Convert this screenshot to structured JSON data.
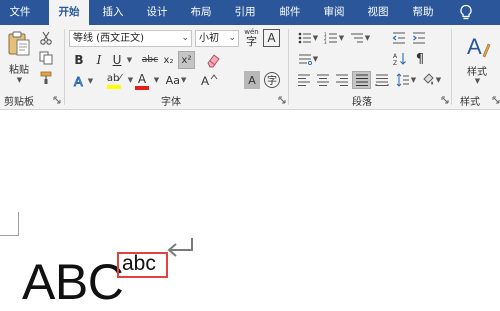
{
  "tabs": [
    {
      "id": "file",
      "label": "文件"
    },
    {
      "id": "home",
      "label": "开始",
      "active": true
    },
    {
      "id": "insert",
      "label": "插入"
    },
    {
      "id": "design",
      "label": "设计"
    },
    {
      "id": "layout",
      "label": "布局"
    },
    {
      "id": "references",
      "label": "引用"
    },
    {
      "id": "mailings",
      "label": "邮件"
    },
    {
      "id": "review",
      "label": "审阅"
    },
    {
      "id": "view",
      "label": "视图"
    },
    {
      "id": "help",
      "label": "帮助"
    }
  ],
  "tab_bar_icon": "lightbulb-icon",
  "clipboard": {
    "paste_label": "粘贴",
    "group_label": "剪贴板",
    "icons": [
      "clipboard-paste-icon",
      "cut-icon",
      "copy-icon",
      "format-painter-icon"
    ]
  },
  "font": {
    "font_name": "等线 (西文正文)",
    "font_size": "小初",
    "group_label": "字体",
    "pinyin_label": "wén",
    "buttons": {
      "bold": "B",
      "italic": "I",
      "underline": "U",
      "strikethrough": "abc",
      "subscript": "x₂",
      "superscript": "x²",
      "font_color": "A",
      "change_case": "Aa",
      "char_border": "A",
      "char_shading": "A",
      "enclose": "字"
    },
    "superscript_active": true
  },
  "paragraph": {
    "group_label": "段落",
    "icons": [
      "bullets-icon",
      "numbering-icon",
      "multilevel-list-icon",
      "decrease-indent-icon",
      "increase-indent-icon",
      "chinese-layout-icon",
      "sort-icon",
      "show-marks-icon",
      "align-left-icon",
      "align-center-icon",
      "align-right-icon",
      "justify-icon",
      "distributed-icon",
      "line-spacing-icon",
      "shading-icon",
      "borders-icon"
    ]
  },
  "styles": {
    "styles_label": "样式",
    "group_label": "样式",
    "icon": "styles-icon"
  },
  "document": {
    "main_text": "ABC",
    "superscript_text": "abc",
    "highlight_color": "#e2433f"
  },
  "colors": {
    "tab_bar": "#2b579a",
    "ribbon": "#f3f3f3",
    "highlight_yellow": "#ffff00",
    "font_red": "#e0201b"
  }
}
